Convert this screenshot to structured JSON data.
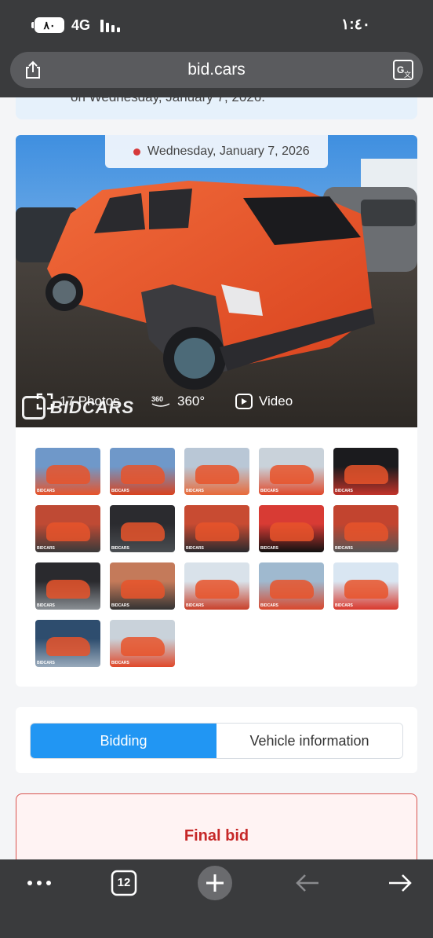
{
  "status_bar": {
    "battery": "٨٠",
    "network": "4G",
    "time": "١:٤٠"
  },
  "browser": {
    "url": "bid.cars",
    "tab_count": "12"
  },
  "page": {
    "top_banner_text": "on Wednesday, January 7, 2026.",
    "gallery": {
      "date": "Wednesday, January 7, 2026",
      "photos_label": "17 Photos",
      "view360_label": "360°",
      "video_label": "Video",
      "watermark": "BIDCARS",
      "thumb_watermark": "BIDCARS"
    },
    "tabs": [
      {
        "label": "Bidding",
        "active": true
      },
      {
        "label": "Vehicle information",
        "active": false
      }
    ],
    "final_bid_label": "Final bid"
  },
  "colors": {
    "accent": "#2196f3",
    "bid_red": "#c62828",
    "chrome_dark": "#3a3b3d",
    "car_orange": "#e8532a"
  },
  "icons": [
    "share-icon",
    "translate-icon",
    "fullscreen-icon",
    "360-icon",
    "video-icon",
    "more-icon",
    "tabs-icon",
    "new-tab-icon",
    "back-icon",
    "forward-icon"
  ]
}
